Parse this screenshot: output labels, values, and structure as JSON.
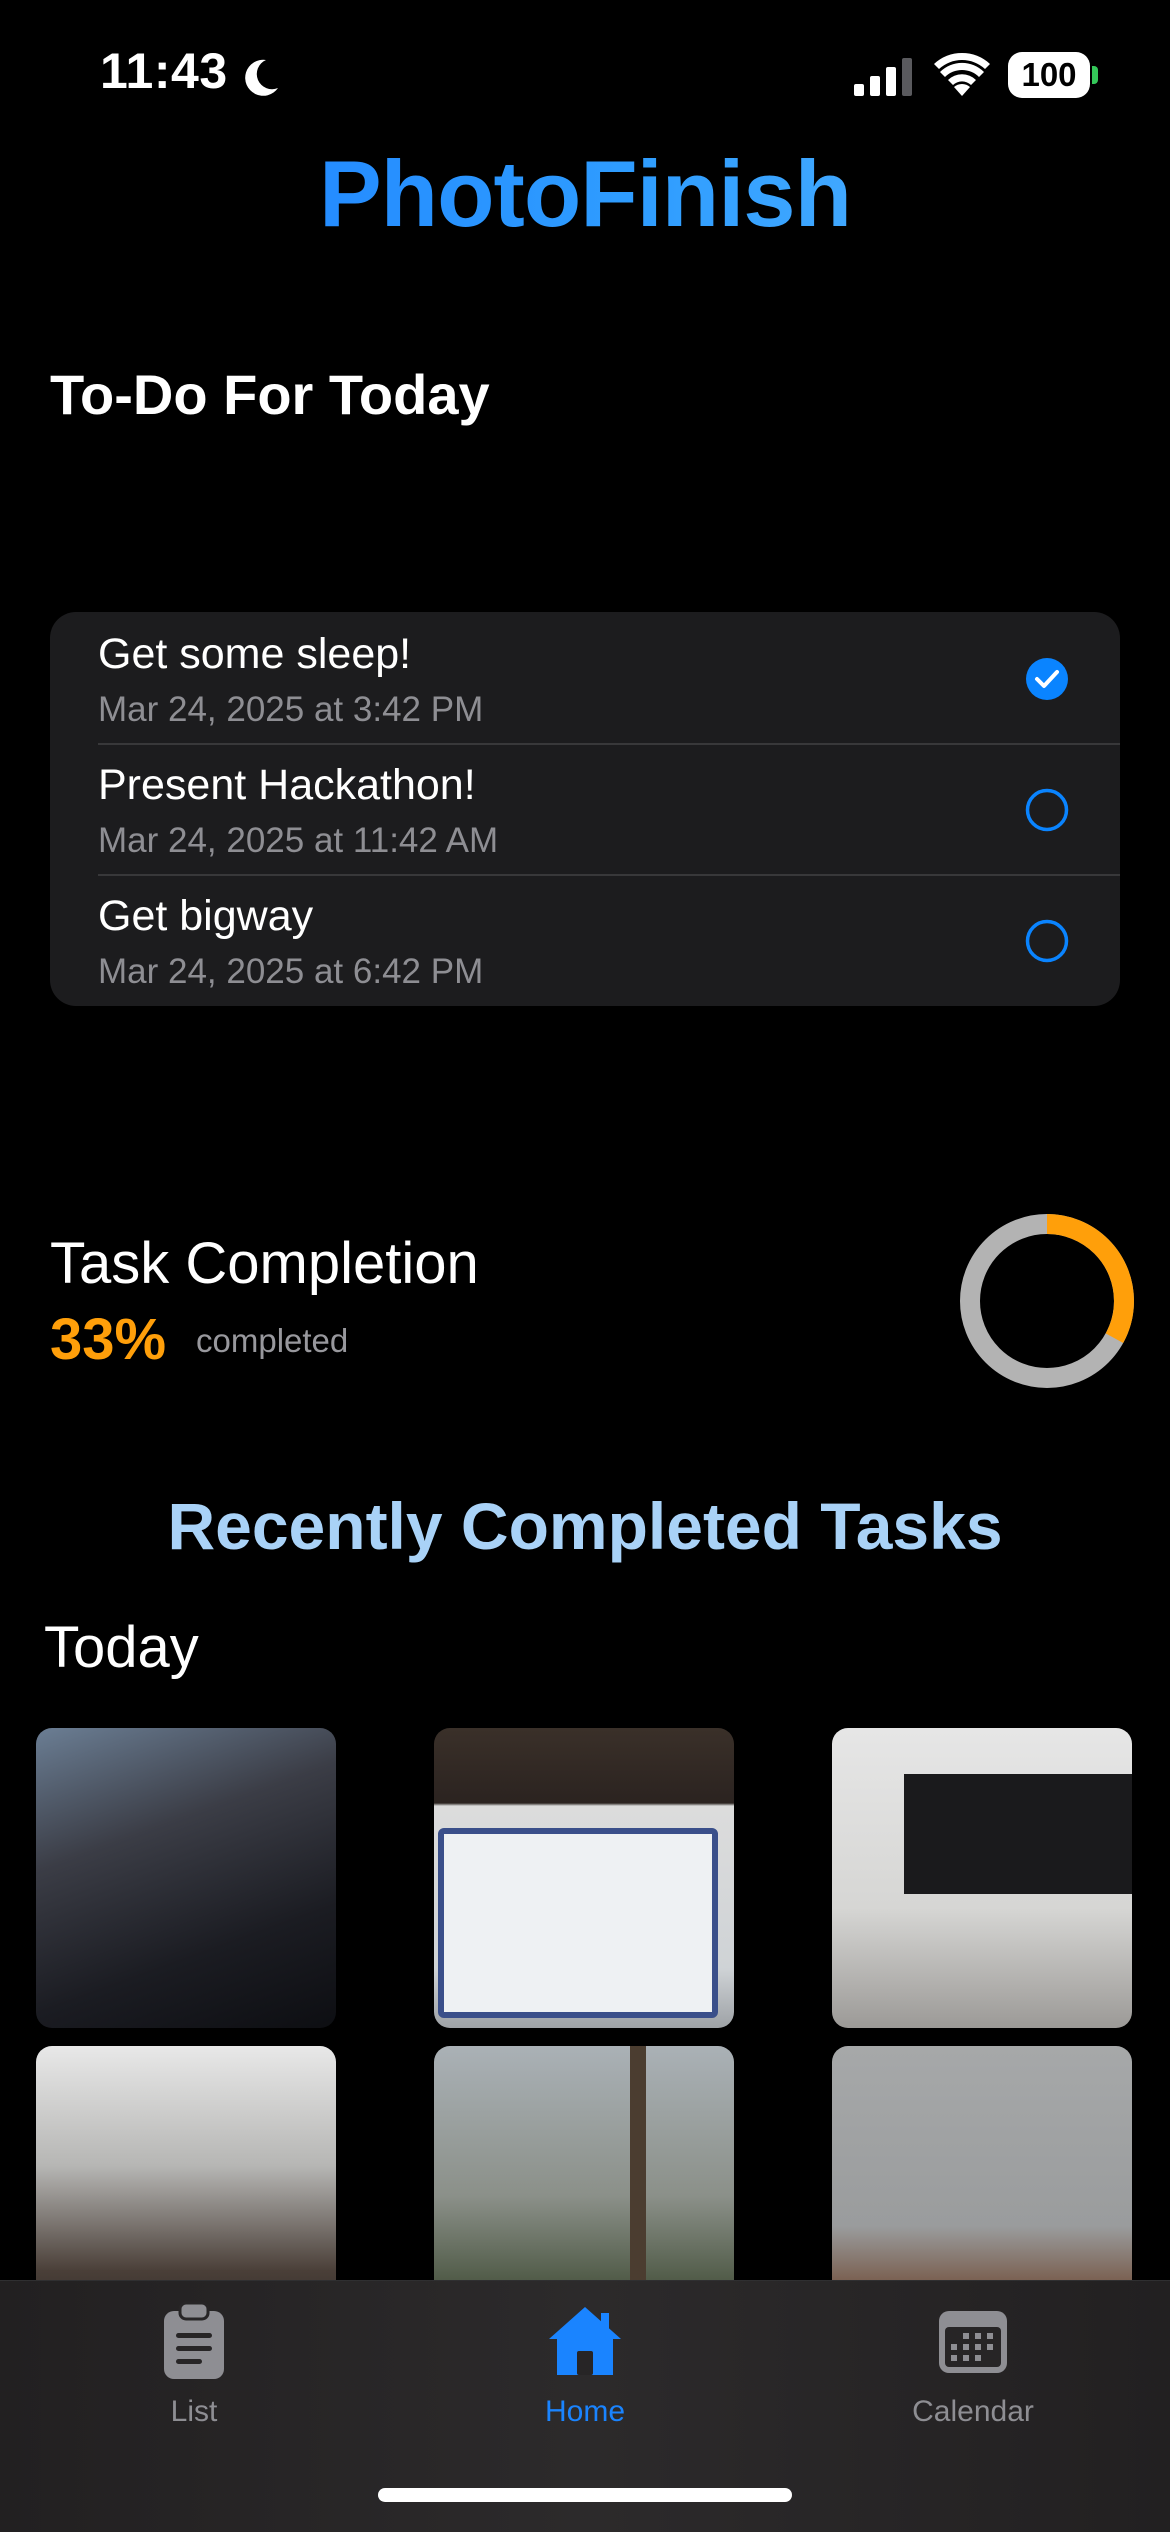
{
  "status_bar": {
    "time": "11:43",
    "battery": "100",
    "icons": [
      "moon-icon",
      "signal-icon",
      "wifi-icon",
      "battery-icon"
    ]
  },
  "app": {
    "title": "PhotoFinish"
  },
  "todo": {
    "heading": "To-Do For Today",
    "tasks": [
      {
        "title": "Get some sleep!",
        "date": "Mar 24, 2025 at 3:42 PM",
        "completed": true
      },
      {
        "title": "Present Hackathon!",
        "date": "Mar 24, 2025 at 11:42 AM",
        "completed": false
      },
      {
        "title": "Get bigway",
        "date": "Mar 24, 2025 at 6:42 PM",
        "completed": false
      }
    ]
  },
  "completion": {
    "title": "Task Completion",
    "percent_text": "33%",
    "label": "completed",
    "fraction": 0.33
  },
  "recent": {
    "heading": "Recently Completed Tasks",
    "group_label": "Today",
    "photo_count": 6
  },
  "tab_bar": {
    "tabs": [
      {
        "label": "List",
        "icon": "clipboard-icon",
        "active": false
      },
      {
        "label": "Home",
        "icon": "house-icon",
        "active": true
      },
      {
        "label": "Calendar",
        "icon": "calendar-icon",
        "active": false
      }
    ]
  },
  "colors": {
    "accent_blue": "#1a84ff",
    "completion_orange": "#ff9f0a",
    "ring_track": "#b3b3b3",
    "recent_heading": "#a9d2f7",
    "card_background": "#1c1c1e"
  }
}
